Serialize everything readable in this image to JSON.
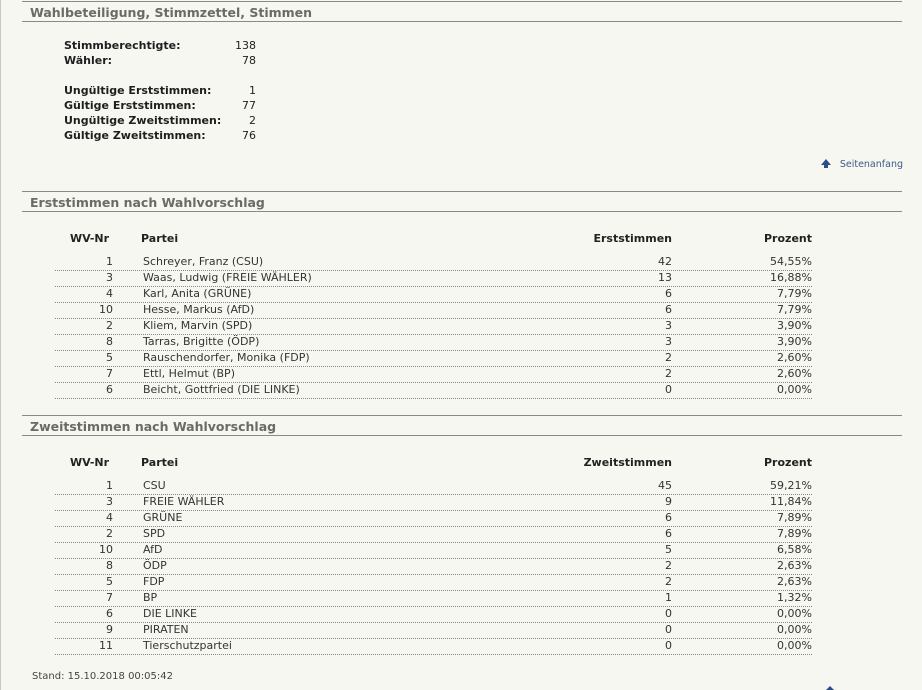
{
  "section1": {
    "title": "Wahlbeteiligung, Stimmzettel, Stimmen",
    "stats": [
      {
        "label": "Stimmberechtigte:",
        "value": "138"
      },
      {
        "label": "Wähler:",
        "value": "78"
      },
      {
        "label": "Ungültige Erststimmen:",
        "value": "1"
      },
      {
        "label": "Gültige Erststimmen:",
        "value": "77"
      },
      {
        "label": "Ungültige Zweitstimmen:",
        "value": "2"
      },
      {
        "label": "Gültige Zweitstimmen:",
        "value": "76"
      }
    ],
    "top_link": "Seitenanfang"
  },
  "section2": {
    "title": "Erststimmen nach Wahlvorschlag",
    "headers": {
      "nr": "WV-Nr",
      "party": "Partei",
      "votes": "Erststimmen",
      "pct": "Prozent"
    },
    "rows": [
      {
        "nr": "1",
        "party": "Schreyer, Franz (CSU)",
        "votes": "42",
        "pct": "54,55%"
      },
      {
        "nr": "3",
        "party": "Waas, Ludwig (FREIE WÄHLER)",
        "votes": "13",
        "pct": "16,88%"
      },
      {
        "nr": "4",
        "party": "Karl, Anita (GRÜNE)",
        "votes": "6",
        "pct": "7,79%"
      },
      {
        "nr": "10",
        "party": "Hesse, Markus (AfD)",
        "votes": "6",
        "pct": "7,79%"
      },
      {
        "nr": "2",
        "party": "Kliem, Marvin (SPD)",
        "votes": "3",
        "pct": "3,90%"
      },
      {
        "nr": "8",
        "party": "Tarras, Brigitte (ÖDP)",
        "votes": "3",
        "pct": "3,90%"
      },
      {
        "nr": "5",
        "party": "Rauschendorfer, Monika (FDP)",
        "votes": "2",
        "pct": "2,60%"
      },
      {
        "nr": "7",
        "party": "Ettl, Helmut (BP)",
        "votes": "2",
        "pct": "2,60%"
      },
      {
        "nr": "6",
        "party": "Beicht, Gottfried (DIE LINKE)",
        "votes": "0",
        "pct": "0,00%"
      }
    ]
  },
  "section3": {
    "title": "Zweitstimmen nach Wahlvorschlag",
    "headers": {
      "nr": "WV-Nr",
      "party": "Partei",
      "votes": "Zweitstimmen",
      "pct": "Prozent"
    },
    "rows": [
      {
        "nr": "1",
        "party": "CSU",
        "votes": "45",
        "pct": "59,21%"
      },
      {
        "nr": "3",
        "party": "FREIE WÄHLER",
        "votes": "9",
        "pct": "11,84%"
      },
      {
        "nr": "4",
        "party": "GRÜNE",
        "votes": "6",
        "pct": "7,89%"
      },
      {
        "nr": "2",
        "party": "SPD",
        "votes": "6",
        "pct": "7,89%"
      },
      {
        "nr": "10",
        "party": "AfD",
        "votes": "5",
        "pct": "6,58%"
      },
      {
        "nr": "8",
        "party": "ÖDP",
        "votes": "2",
        "pct": "2,63%"
      },
      {
        "nr": "5",
        "party": "FDP",
        "votes": "2",
        "pct": "2,63%"
      },
      {
        "nr": "7",
        "party": "BP",
        "votes": "1",
        "pct": "1,32%"
      },
      {
        "nr": "6",
        "party": "DIE LINKE",
        "votes": "0",
        "pct": "0,00%"
      },
      {
        "nr": "9",
        "party": "PIRATEN",
        "votes": "0",
        "pct": "0,00%"
      },
      {
        "nr": "11",
        "party": "Tierschutzpartei",
        "votes": "0",
        "pct": "0,00%"
      }
    ]
  },
  "footer": {
    "stand": "Stand: 15.10.2018 00:05:42"
  }
}
